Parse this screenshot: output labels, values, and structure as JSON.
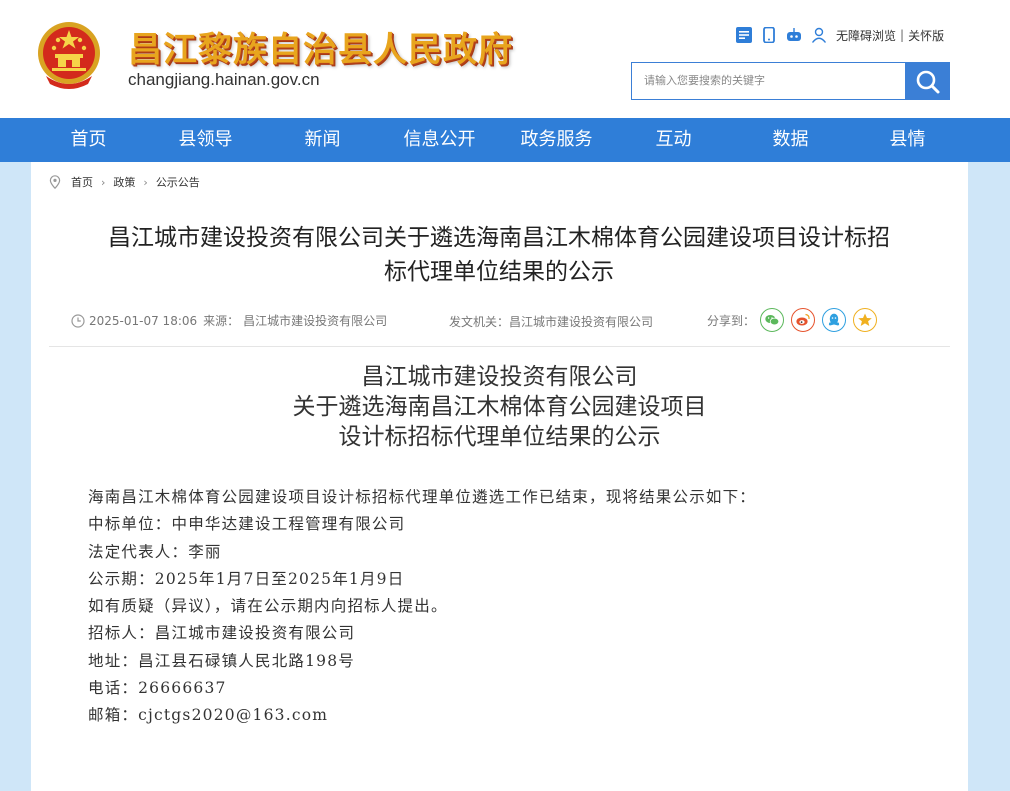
{
  "header": {
    "site_title": "昌江黎族自治县人民政府",
    "site_domain": "changjiang.hainan.gov.cn",
    "accessibility_label": "无障碍浏览",
    "care_mode_label": "关怀版",
    "search_placeholder": "请输入您要搜索的关键字"
  },
  "nav": {
    "items": [
      "首页",
      "县领导",
      "新闻",
      "信息公开",
      "政务服务",
      "互动",
      "数据",
      "县情"
    ]
  },
  "breadcrumb": [
    "首页",
    "政策",
    "公示公告"
  ],
  "article": {
    "title_line1": "昌江城市建设投资有限公司关于遴选海南昌江木棉体育公园建设项目设计标招",
    "title_line2": "标代理单位结果的公示",
    "date": "2025-01-07 18:06",
    "source_label": "来源：",
    "source": "昌江城市建设投资有限公司",
    "issuer_label": "发文机关：",
    "issuer": "昌江城市建设投资有限公司",
    "share_label": "分享到：",
    "heading_line1": "昌江城市建设投资有限公司",
    "heading_line2": "关于遴选海南昌江木棉体育公园建设项目",
    "heading_line3": "设计标招标代理单位结果的公示",
    "paragraphs": [
      "海南昌江木棉体育公园建设项目设计标招标代理单位遴选工作已结束，现将结果公示如下：",
      "中标单位：中申华达建设工程管理有限公司",
      "法定代表人：李丽",
      "公示期：2025年1月7日至2025年1月9日",
      "如有质疑（异议），请在公示期内向招标人提出。",
      "招标人：昌江城市建设投资有限公司",
      "地址：昌江县石碌镇人民北路198号",
      "电话：26666637",
      "邮箱：cjctgs2020@163.com"
    ]
  },
  "colors": {
    "nav_bg": "#2f7ed8",
    "title_gold": "#e8a51e",
    "page_bg": "#cfe6f8"
  },
  "icons": {
    "emblem": "national-emblem-icon",
    "toolbar": [
      "qr-code-icon",
      "mobile-icon",
      "weibo-robot-icon",
      "user-icon"
    ],
    "share": [
      "wechat-icon",
      "weibo-icon",
      "qq-icon",
      "qzone-icon"
    ]
  }
}
